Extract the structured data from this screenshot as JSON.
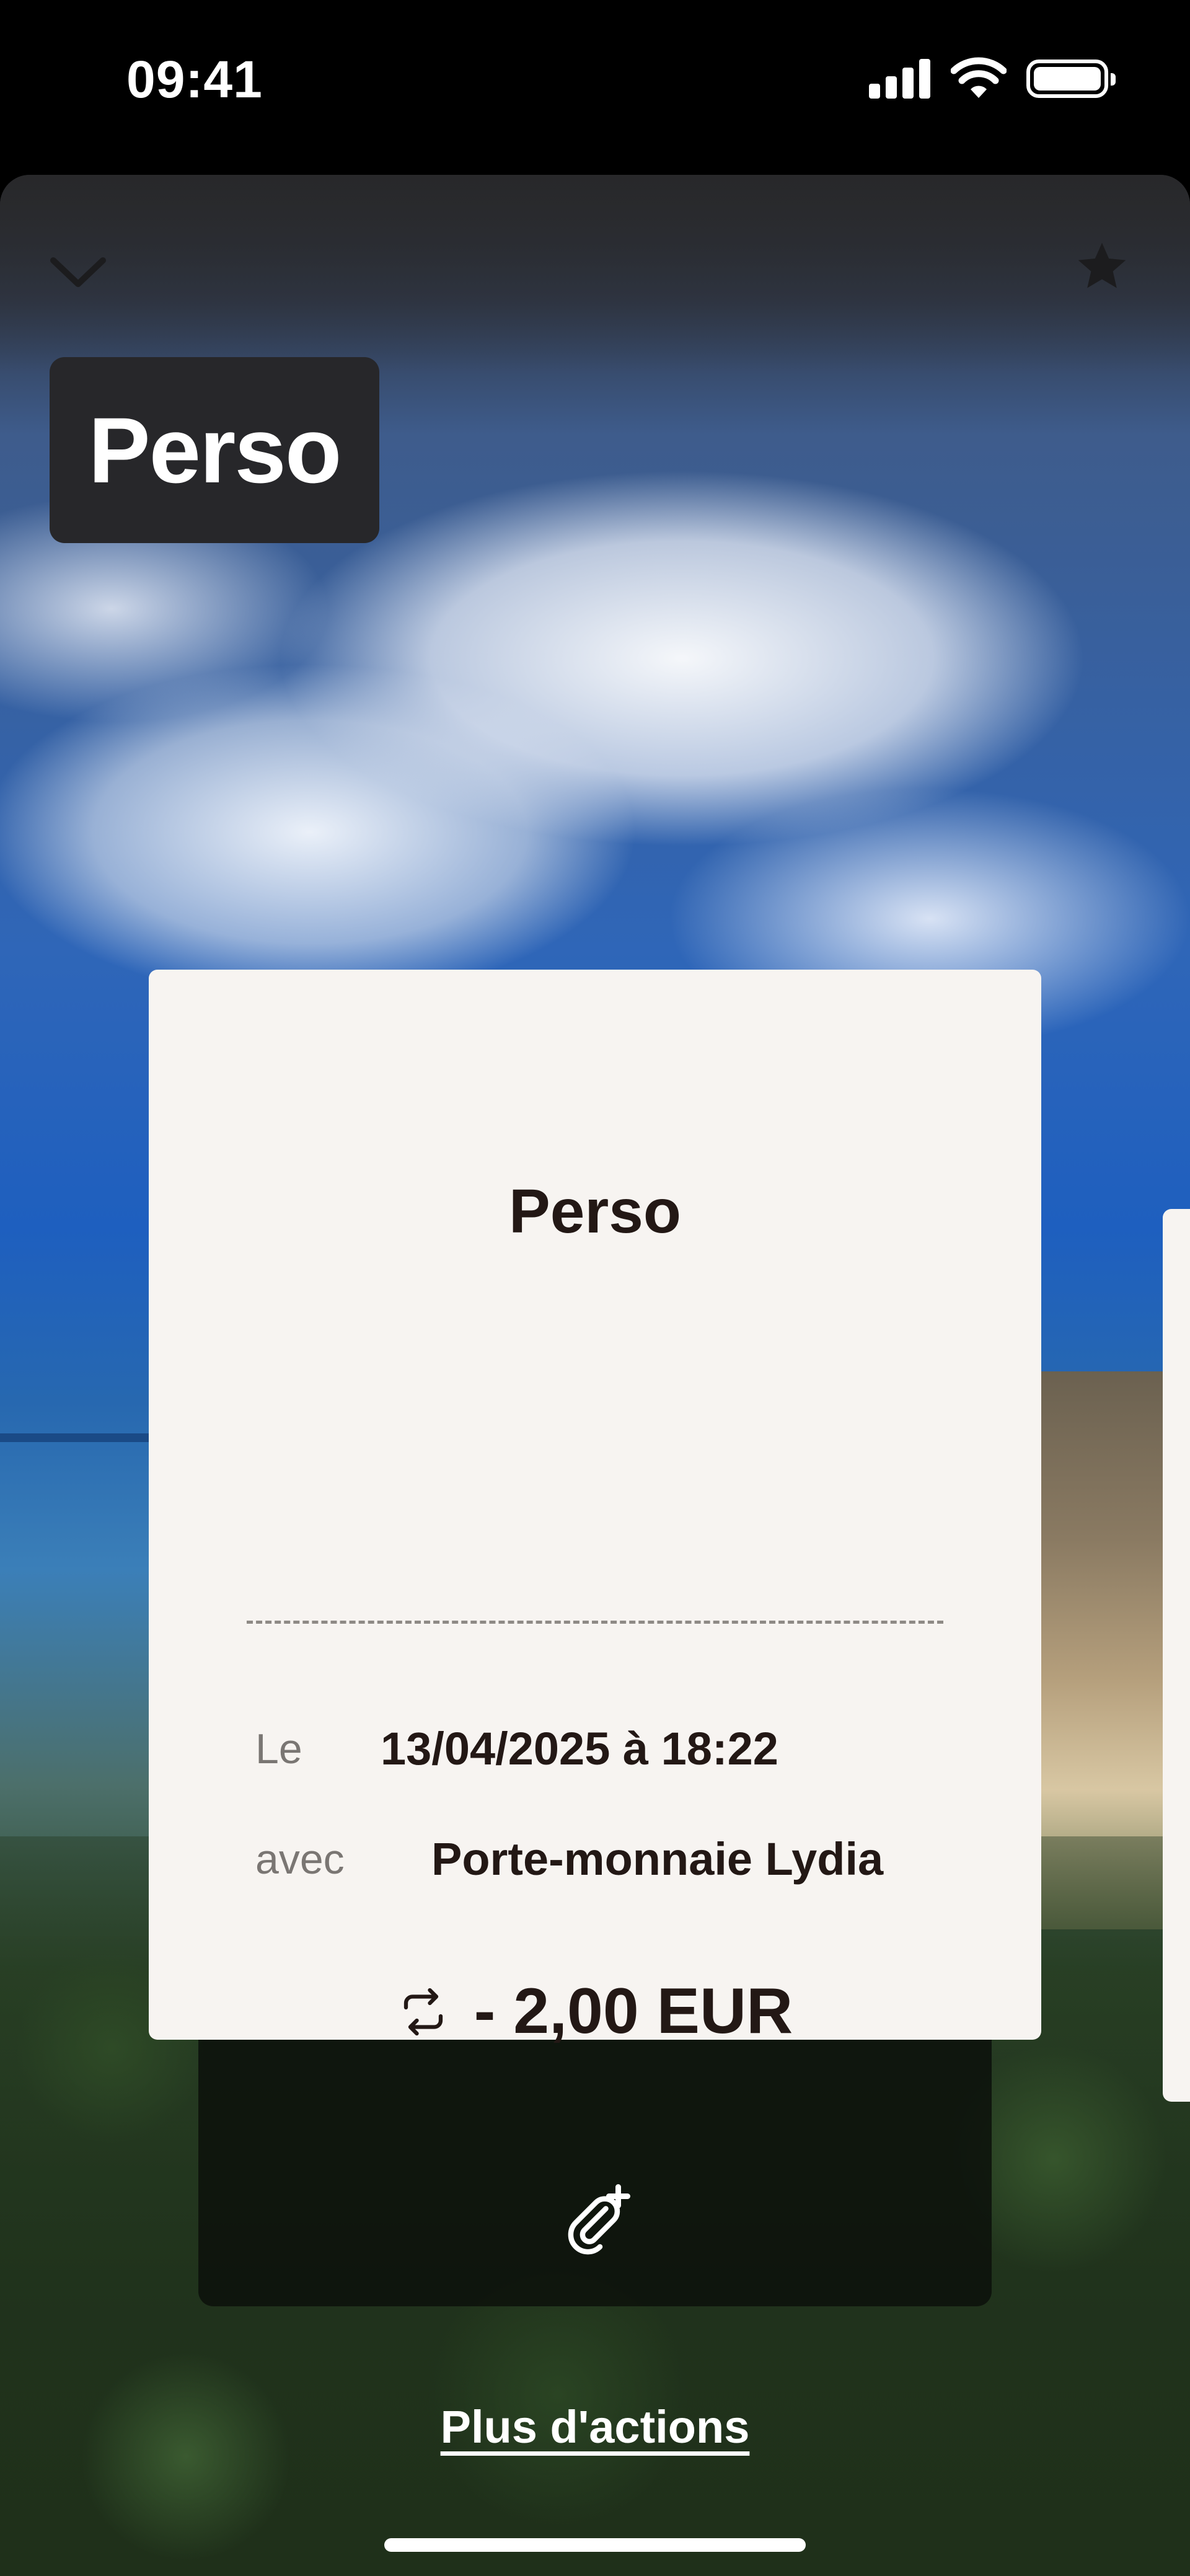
{
  "status_bar": {
    "time": "09:41"
  },
  "header": {
    "badge_title": "Perso"
  },
  "ticket": {
    "title": "Perso",
    "date_label": "Le",
    "date_value": "13/04/2025 à 18:22",
    "with_label": "avec",
    "with_value": "Porte-monnaie Lydia",
    "amount": "- 2,00 EUR"
  },
  "actions": {
    "more_label": "Plus d'actions"
  },
  "colors": {
    "card_bg": "#f7f4f1",
    "text_dark": "#231815",
    "label_gray": "#7a7673"
  },
  "icons": [
    "chevron-down-icon",
    "star-icon",
    "repeat-icon",
    "attachment-add-icon",
    "signal-icon",
    "wifi-icon",
    "battery-icon"
  ]
}
